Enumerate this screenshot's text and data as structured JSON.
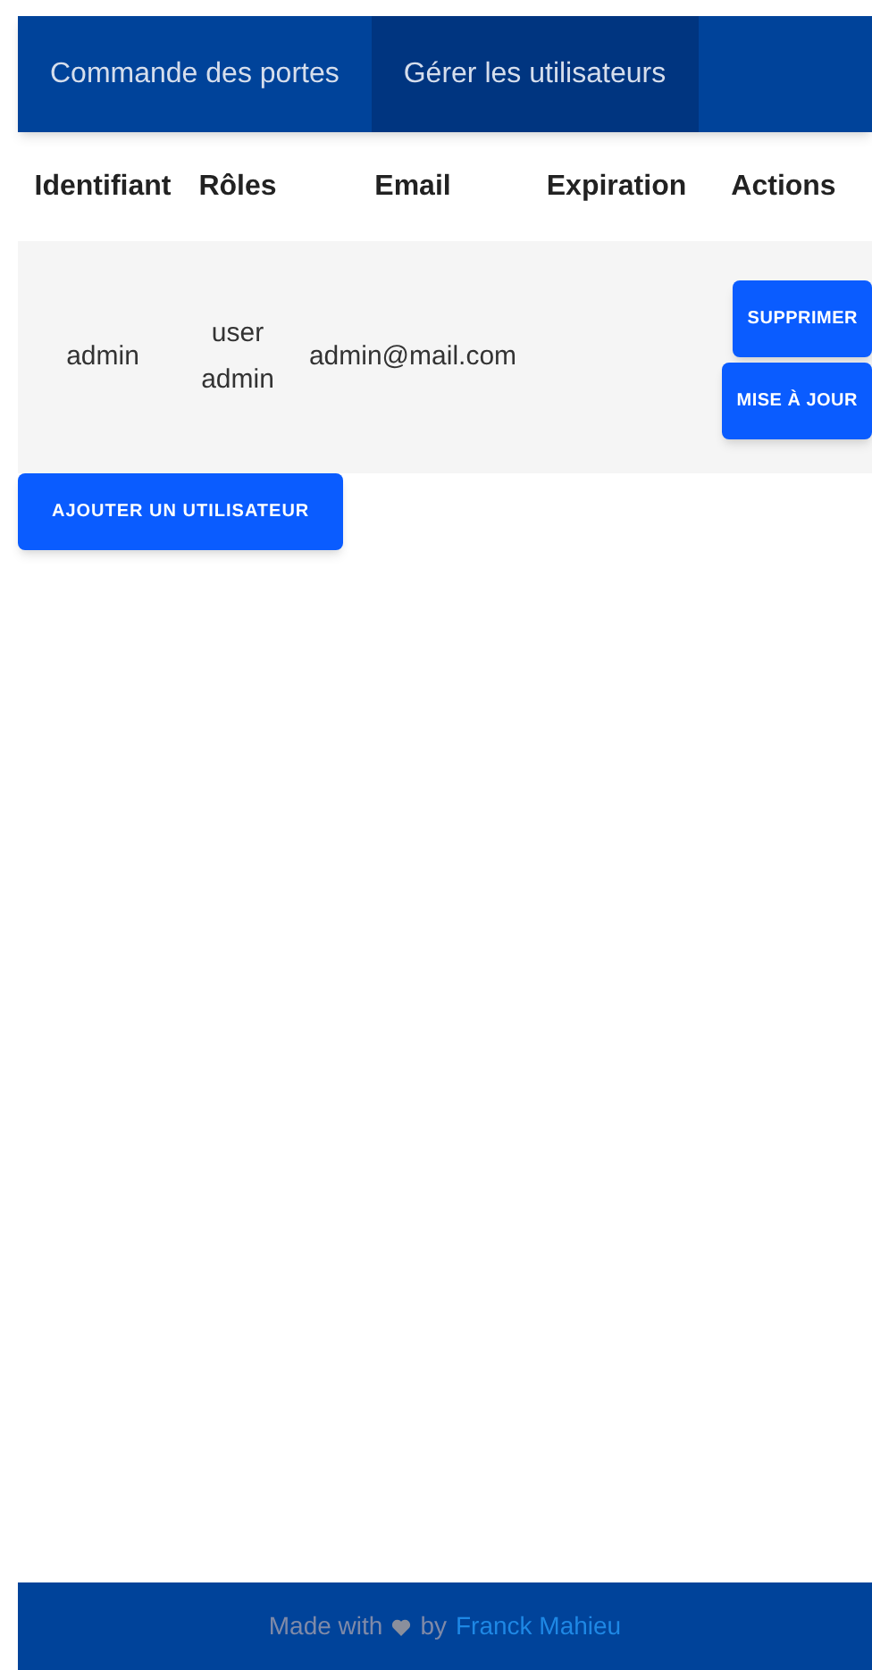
{
  "tabs": [
    {
      "label": "Commande des portes",
      "selected": false
    },
    {
      "label": "Gérer les utilisateurs",
      "selected": true
    }
  ],
  "table": {
    "columns": [
      "Identifiant",
      "Rôles",
      "Email",
      "Expiration",
      "Actions"
    ],
    "rows": [
      {
        "id": "admin",
        "roles": [
          "user",
          "admin"
        ],
        "email": "admin@mail.com",
        "actions": [
          "SUPPRIMER",
          "MISE À JOUR"
        ]
      }
    ]
  },
  "add_button": "AJOUTER UN UTILISATEUR",
  "footer": {
    "before": "Made with",
    "after": "by",
    "author": "Franck Mahieu"
  }
}
